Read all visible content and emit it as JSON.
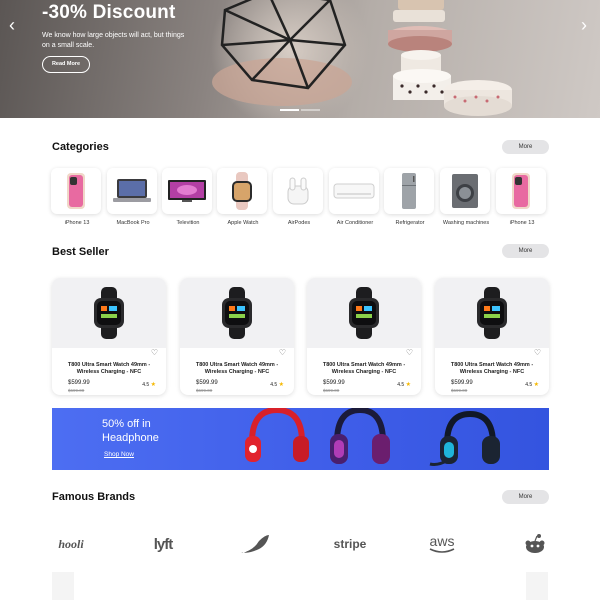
{
  "hero": {
    "title": "-30% Discount",
    "subtitle": "We know how large objects will act, but things on a small scale.",
    "button": "Read More",
    "prev": "‹",
    "next": "›"
  },
  "categories": {
    "title": "Categories",
    "more": "More",
    "items": [
      {
        "label": "iPhone 13",
        "icon": "phone-icon"
      },
      {
        "label": "MacBook Pro",
        "icon": "laptop-icon"
      },
      {
        "label": "Televition",
        "icon": "tv-icon"
      },
      {
        "label": "Apple Watch",
        "icon": "watch-icon"
      },
      {
        "label": "AirPodes",
        "icon": "airpods-icon"
      },
      {
        "label": "Air Conditioner",
        "icon": "air-conditioner-icon"
      },
      {
        "label": "Refrigerator",
        "icon": "fridge-icon"
      },
      {
        "label": "Washing machines",
        "icon": "washing-machine-icon"
      },
      {
        "label": "iPhone 13",
        "icon": "phone-icon"
      }
    ]
  },
  "best_seller": {
    "title": "Best Seller",
    "more": "More",
    "products": [
      {
        "name": "T800 Ultra Smart Watch 49mm - Wireless Charging - NFC",
        "price": "$599.99",
        "old_price": "$699.00",
        "rating": "4.5"
      },
      {
        "name": "T800 Ultra Smart Watch 49mm - Wireless Charging - NFC",
        "price": "$599.99",
        "old_price": "$699.00",
        "rating": "4.5"
      },
      {
        "name": "T800 Ultra Smart Watch 49mm - Wireless Charging - NFC",
        "price": "$599.99",
        "old_price": "$699.00",
        "rating": "4.5"
      },
      {
        "name": "T800 Ultra Smart Watch 49mm - Wireless Charging - NFC",
        "price": "$599.99",
        "old_price": "$699.00",
        "rating": "4.5"
      }
    ]
  },
  "banner": {
    "line1": "50% off in",
    "line2": "Headphone",
    "link": "Shop Now"
  },
  "brands": {
    "title": "Famous Brands",
    "more": "More",
    "items": [
      "hooli",
      "lyft",
      "",
      "stripe",
      "aws",
      ""
    ]
  },
  "colors": {
    "banner_blue": "#4d6ef2",
    "star": "#f5b800",
    "more_button": "#e4e4e6"
  }
}
